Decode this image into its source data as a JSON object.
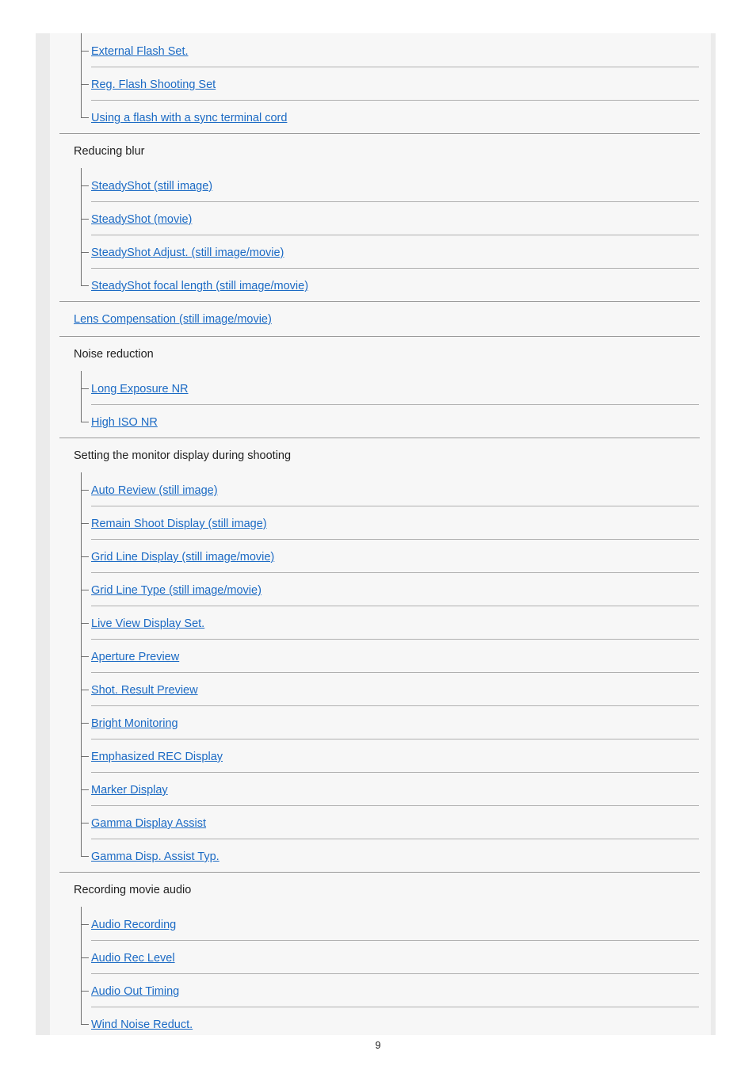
{
  "document": {
    "page_number": "9",
    "link_color": "#1b6ac4",
    "text_color": "#222222",
    "panel_bg": "#f7f7f7",
    "gutter_bg": "#ebebeb",
    "rule_color": "#9a9a9a",
    "subrule_color": "#b0b0b0",
    "tree_color": "#6f6f6f"
  },
  "toc": {
    "groups": [
      {
        "type": "continued-children",
        "header": null,
        "children": [
          {
            "label": "External Flash Set."
          },
          {
            "label": "Reg. Flash Shooting Set"
          },
          {
            "label": "Using a flash with a sync terminal cord"
          }
        ]
      },
      {
        "type": "section",
        "header": "Reducing blur",
        "children": [
          {
            "label": "SteadyShot (still image)"
          },
          {
            "label": "SteadyShot (movie)"
          },
          {
            "label": "SteadyShot Adjust. (still image/movie)"
          },
          {
            "label": "SteadyShot focal length (still image/movie)"
          }
        ]
      },
      {
        "type": "link",
        "header": "Lens Compensation (still image/movie)",
        "children": []
      },
      {
        "type": "section",
        "header": "Noise reduction",
        "children": [
          {
            "label": "Long Exposure NR"
          },
          {
            "label": "High ISO NR"
          }
        ]
      },
      {
        "type": "section",
        "header": "Setting the monitor display during shooting",
        "children": [
          {
            "label": "Auto Review (still image)"
          },
          {
            "label": "Remain Shoot Display (still image)"
          },
          {
            "label": "Grid Line Display (still image/movie)"
          },
          {
            "label": "Grid Line Type (still image/movie)"
          },
          {
            "label": "Live View Display Set."
          },
          {
            "label": "Aperture Preview"
          },
          {
            "label": "Shot. Result Preview"
          },
          {
            "label": "Bright Monitoring"
          },
          {
            "label": "Emphasized REC Display"
          },
          {
            "label": "Marker Display"
          },
          {
            "label": "Gamma Display Assist"
          },
          {
            "label": "Gamma Disp. Assist Typ."
          }
        ]
      },
      {
        "type": "section",
        "header": "Recording movie audio",
        "children": [
          {
            "label": "Audio Recording"
          },
          {
            "label": "Audio Rec Level"
          },
          {
            "label": "Audio Out Timing"
          },
          {
            "label": "Wind Noise Reduct."
          }
        ]
      }
    ]
  }
}
